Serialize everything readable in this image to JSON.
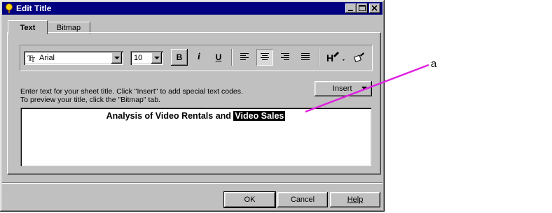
{
  "window": {
    "title": "Edit Title",
    "controls": {
      "minimize": "_",
      "maximize": "□",
      "close": "✕"
    }
  },
  "tabs": [
    {
      "label": "Text",
      "active": true
    },
    {
      "label": "Bitmap",
      "active": false
    }
  ],
  "toolbar": {
    "font_name": "Arial",
    "font_size": "10",
    "bold_label": "B",
    "italic_label": "i",
    "underline_label": "U",
    "alignment_selected": "center"
  },
  "instructions": {
    "line1": "Enter text for your sheet title. Click \"Insert\" to add special text codes.",
    "line2": "To preview your title, click the \"Bitmap\" tab."
  },
  "insert_button": {
    "label": "Insert"
  },
  "editor": {
    "text_plain": "Analysis of Video Rentals and ",
    "text_selected": "Video Sales"
  },
  "buttons": {
    "ok": "OK",
    "cancel": "Cancel",
    "help": "Help"
  },
  "annotation": {
    "label": "a",
    "color": "#e020e0"
  },
  "colors": {
    "titlebar": "#000080",
    "face": "#c0c0c0"
  }
}
